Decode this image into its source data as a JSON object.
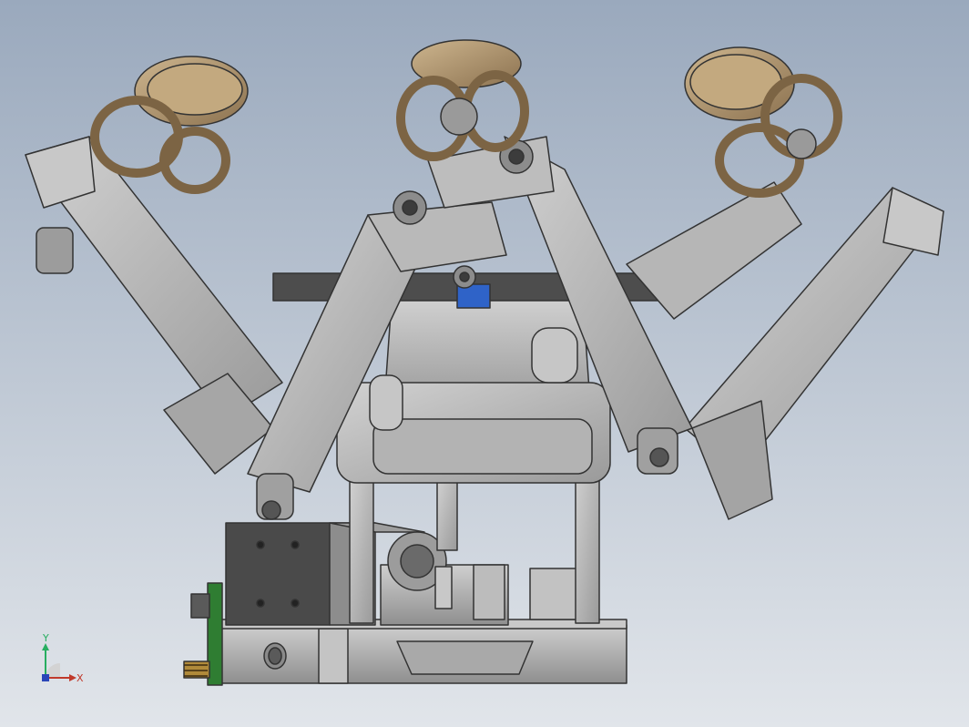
{
  "viewport": {
    "background_top": "#9aa9bd",
    "background_bottom": "#dfe3e8"
  },
  "model": {
    "metal_color": "#b9b9b9",
    "metal_dark": "#6f6f6f",
    "wheel_color": "#b49a72",
    "motor_color": "#4a4a4a",
    "pcb_color": "#2f7d32",
    "sensor_color": "#2f63c8"
  },
  "triad": {
    "x_label": "X",
    "y_label": "Y",
    "x_color": "#c0392b",
    "y_color": "#27ae60",
    "z_color": "#2a46b8"
  }
}
